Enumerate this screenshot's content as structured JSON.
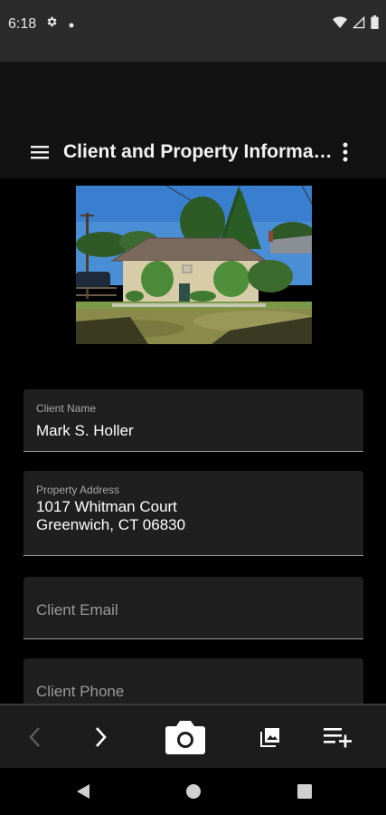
{
  "status_bar": {
    "time": "6:18",
    "left_icons": [
      "gear-icon",
      "dot-icon"
    ],
    "right_icons": [
      "wifi-icon",
      "signal-icon",
      "battery-icon"
    ]
  },
  "app_bar": {
    "title": "Client and Property Information",
    "menu_icon": "hamburger-menu-icon",
    "more_icon": "more-vertical-icon"
  },
  "property_photo": {
    "subject": "house-photo"
  },
  "form": {
    "client_name": {
      "label": "Client Name",
      "value": "Mark S. Holler"
    },
    "property_address": {
      "label": "Property Address",
      "line1": "1017 Whitman Court",
      "line2": "Greenwich, CT 06830"
    },
    "client_email": {
      "placeholder": "Client Email",
      "value": ""
    },
    "client_phone": {
      "placeholder": "Client Phone",
      "value": ""
    }
  },
  "toolbar": {
    "items": [
      "back-icon",
      "forward-icon",
      "camera-icon",
      "gallery-icon",
      "add-to-list-icon"
    ],
    "colors": {
      "active": "#ffffff",
      "disabled": "#5e5e5e"
    }
  },
  "nav_bar": {
    "items": [
      "nav-back-icon",
      "nav-home-icon",
      "nav-recents-icon"
    ]
  }
}
